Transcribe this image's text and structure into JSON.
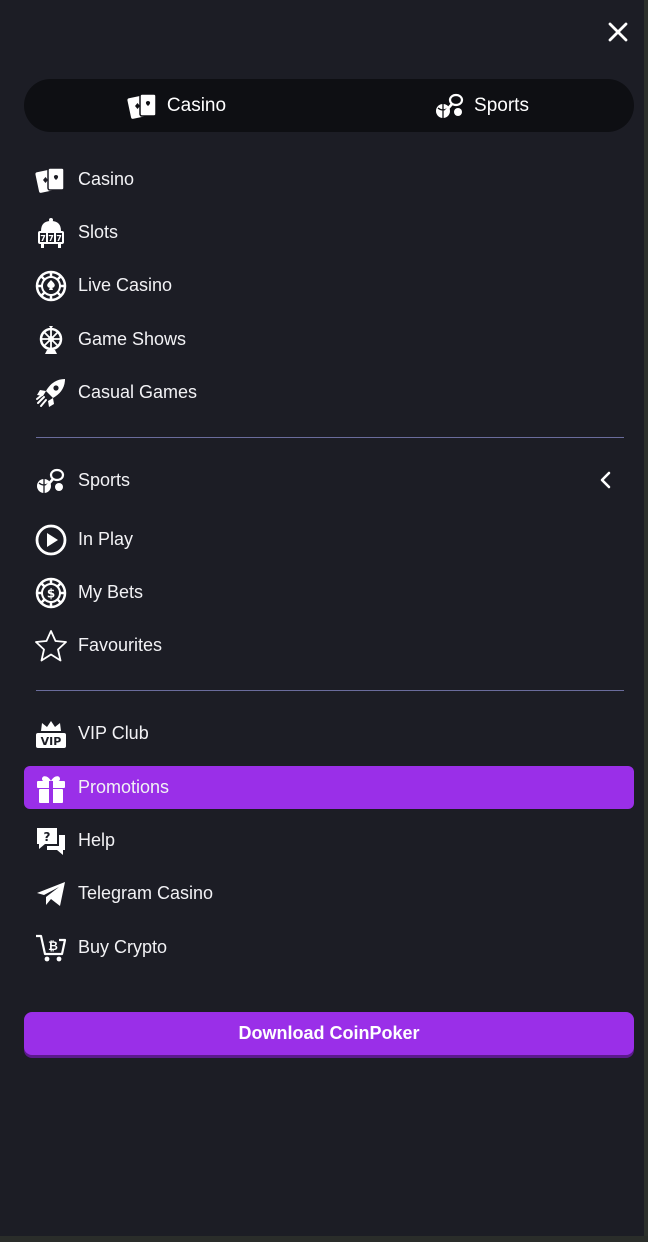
{
  "header": {
    "close_icon": "close-icon"
  },
  "switcher": {
    "tabs": [
      {
        "label": "Casino",
        "icon": "cards-icon"
      },
      {
        "label": "Sports",
        "icon": "sports-icon"
      }
    ]
  },
  "casino_section": {
    "items": [
      {
        "label": "Casino",
        "icon": "cards-icon"
      },
      {
        "label": "Slots",
        "icon": "slot-machine-icon"
      },
      {
        "label": "Live Casino",
        "icon": "chip-icon"
      },
      {
        "label": "Game Shows",
        "icon": "wheel-icon"
      },
      {
        "label": "Casual Games",
        "icon": "rocket-icon"
      }
    ]
  },
  "sports_section": {
    "items": [
      {
        "label": "Sports",
        "icon": "sports-icon",
        "expand_icon": "chevron-left-icon"
      },
      {
        "label": "In Play",
        "icon": "play-icon"
      },
      {
        "label": "My Bets",
        "icon": "dollar-chip-icon"
      },
      {
        "label": "Favourites",
        "icon": "star-icon"
      }
    ]
  },
  "other_section": {
    "items": [
      {
        "label": "VIP Club",
        "icon": "vip-crown-icon"
      },
      {
        "label": "Promotions",
        "icon": "gift-icon",
        "active": true
      },
      {
        "label": "Help",
        "icon": "help-chat-icon"
      },
      {
        "label": "Telegram Casino",
        "icon": "telegram-icon"
      },
      {
        "label": "Buy Crypto",
        "icon": "crypto-cart-icon"
      }
    ]
  },
  "download": {
    "label": "Download CoinPoker"
  },
  "colors": {
    "background": "#1c1d25",
    "switcher_bg": "#0e0f13",
    "accent": "#9a2fe8",
    "divider": "#6a6c9c"
  }
}
